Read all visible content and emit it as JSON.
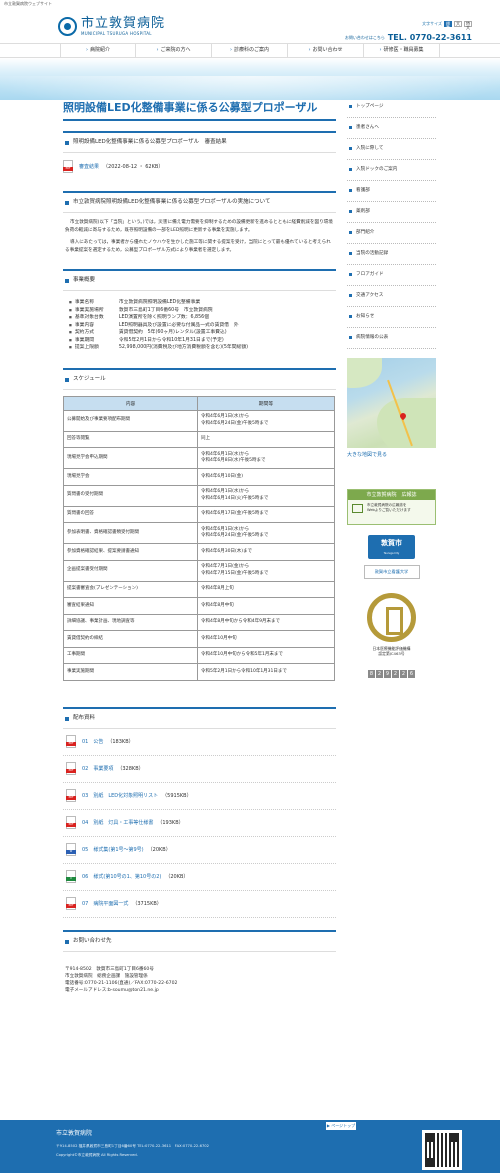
{
  "site": {
    "topline": "市立敦賀病院ウェブサイト",
    "name_ja": "市立敦賀病院",
    "name_en": "MUNICIPAL TSURUGA HOSPITAL"
  },
  "header": {
    "fontsize_label": "文字サイズ",
    "fontsize_options": [
      "標準",
      "大",
      "特大"
    ],
    "tel_label": "お問い合わせはこちら",
    "tel": "TEL. 0770-22-3611"
  },
  "nav": [
    "病院紹介",
    "ご来院の方へ",
    "診療科のご案内",
    "お問い合わせ",
    "研修医・職員募集"
  ],
  "page": {
    "title": "照明設備LED化整備事業に係る公募型プロポーザル"
  },
  "sections": {
    "result": {
      "heading": "照明設備LED化整備事業に係る公募型プロポーザル　審査結果",
      "link": "審査結果",
      "meta": "（2022-08-12 ・ 62KB）"
    },
    "implement": {
      "heading": "市立敦賀病院照明設備LED化整備事業に係る公募型プロポーザルの実施について",
      "p1": "市立敦賀病院(以下「当院」という。)では，災害に備え電力需要を抑制するための設備更新を進めるとともに経費削減を図り環境負荷の軽減に寄与するため，既存照明設備の一部をLED照明に更新する事業を実施します。",
      "p2": "導入にあたっては，事業者から優れたノウハウを生かした施工等に関する提案を受け，当院にとって最も優れていると考えられる事業提案を選定するため，公募型プロポーザル方式により事業者を選定します。"
    },
    "overview": {
      "heading": "事業概要",
      "items": [
        {
          "label": "事業名称",
          "value": "市立敦賀病院照明設備LED化整備事業"
        },
        {
          "label": "事業実施場所",
          "value": "敦賀市三島町1丁目6番60号　市立敦賀病院"
        },
        {
          "label": "基準対象台数",
          "value": "LED演置所を除く照明ランプ数：6,856個"
        },
        {
          "label": "事業内容",
          "value": "LED照明器具及び設置に必要な付属品一式の賃貸借　外"
        },
        {
          "label": "契約方式",
          "value": "賃貸借契約　5年(60ヶ月)レンタル(設置工事費込)"
        },
        {
          "label": "事業期間",
          "value": "令和5年2月1日から令和10年1月31日まで(予定)"
        },
        {
          "label": "提案上限額",
          "value": "52,998,000円(消費税及び地方消費税額を含む)(5年間総額)"
        }
      ]
    },
    "schedule": {
      "heading": "スケジュール",
      "col1": "内容",
      "col2": "期間等",
      "rows": [
        {
          "c": "公募開始及び事業要項配布期間",
          "p": "令和4年6月1日(水)から\n令和4年6月24日(金)午後5時まで"
        },
        {
          "c": "回答等閲覧",
          "p": "同上"
        },
        {
          "c": "現場見学会申込期間",
          "p": "令和4年6月1日(水)から\n令和4年6月8日(水)午後5時まで"
        },
        {
          "c": "現場見学会",
          "p": "令和4年6月10日(金)"
        },
        {
          "c": "質問書の受付期間",
          "p": "令和4年6月1日(水)から\n令和4年6月14日(火)午後5時まで"
        },
        {
          "c": "質問書の回答",
          "p": "令和4年6月17日(金)午後5時まで"
        },
        {
          "c": "参加表明書、資格確認書類受付期間",
          "p": "令和4年6月1日(水)から\n令和4年6月24日(金)午後5時まで"
        },
        {
          "c": "参加資格確認結果、提案要請書通知",
          "p": "令和4年6月30日(木)まで"
        },
        {
          "c": "企画提案書受付期間",
          "p": "令和4年7月1日(金)から\n令和4年7月15日(金)午後5時まで"
        },
        {
          "c": "提案書審査会(プレゼンテーション)",
          "p": "令和4年8月上旬"
        },
        {
          "c": "審査結果通知",
          "p": "令和4年8月中旬"
        },
        {
          "c": "詳細協議、事業計画、現地調査等",
          "p": "令和4年8月中旬から令和4年9月末まで"
        },
        {
          "c": "賃貸借契約の締結",
          "p": "令和4年10月中旬"
        },
        {
          "c": "工事期間",
          "p": "令和4年10月中旬から令和5年1月末まで"
        },
        {
          "c": "事業実施期間",
          "p": "令和5年2月1日から令和10年1月31日まで"
        }
      ]
    },
    "downloads": {
      "heading": "配布資料",
      "items": [
        {
          "name": "01　公告",
          "size": "（183KB）",
          "icon": "pdf-icon"
        },
        {
          "name": "02　事業要項",
          "size": "（328KB）",
          "icon": "pdf-icon"
        },
        {
          "name": "03　別紙　LED化対象照明リスト",
          "size": "（5915KB）",
          "icon": "pdf-icon"
        },
        {
          "name": "04　別紙　灯具・工事等仕様書",
          "size": "（193KB）",
          "icon": "pdf-icon"
        },
        {
          "name": "05　様式集(第1号～第9号)",
          "size": "（20KB）",
          "icon": "word-icon"
        },
        {
          "name": "06　様式(第10号の1、第10号の2)",
          "size": "（20KB）",
          "icon": "excel-icon"
        },
        {
          "name": "07　病院平面図一式",
          "size": "（3715KB）",
          "icon": "pdf-icon"
        }
      ]
    },
    "contact": {
      "heading": "お問い合わせ先",
      "lines": [
        "〒914-8502　敦賀市三島町1丁目6番60号",
        "市立敦賀病院　総務企画課　施設管理係",
        "電話番号:0770-21-1106(直通)／FAX:0770-22-6702",
        "電子メールアドレス:b-soumu@ton21.ne.jp"
      ]
    }
  },
  "sidebar": {
    "items": [
      "トップページ",
      "患者さんへ",
      "入院に際して",
      "入院ドックのご案内",
      "看護部",
      "薬剤部",
      "部門紹介",
      "当院の活動記録",
      "フロアガイド",
      "交通アクセス",
      "お知らせ",
      "病院情報の公表"
    ],
    "map_link": "大きな地図で見る",
    "kouhou_title": "市立敦賀病院　広報誌",
    "kouhou_text1": "市立敦賀病院の広報誌を",
    "kouhou_text2": "Webよりご覧いただけます",
    "city_name": "敦賀市",
    "city_en": "Tsuruga City",
    "univ_name": "敦賀市立看護大学",
    "jcqhc_text1": "日本医療機能評価機構",
    "jcqhc_text2": "認定第JC463号",
    "counter": [
      "8",
      "2",
      "9",
      "2",
      "2",
      "6"
    ]
  },
  "footer": {
    "name": "市立敦賀病院",
    "address": "〒914-8502 福井県敦賀市三島町1丁目6番60号 TEL:0770-22-3611　FAX:0770-22-6702",
    "copyright": "Copyright©市立敦賀病院 All Rights Reserved.",
    "pagetop": "▶ ページトップ"
  }
}
